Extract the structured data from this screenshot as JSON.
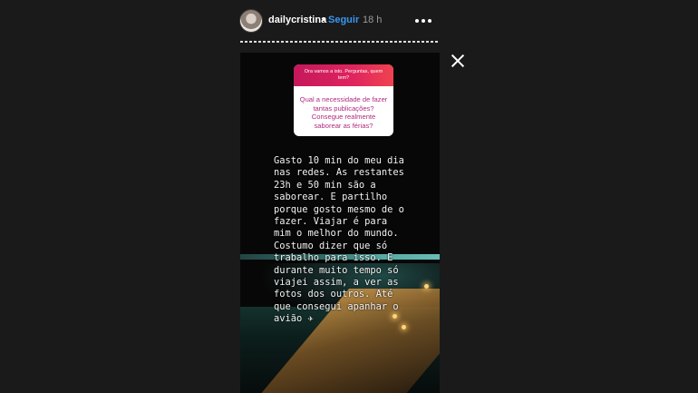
{
  "header": {
    "username": "dailycristina",
    "separator": "•",
    "follow_label": "Seguir",
    "time": "18 h"
  },
  "story": {
    "question_prompt": "Ora vamos a isto. Perguntas, quem tem?",
    "question_text": "Qual a necessidade de fazer tantas publicações? Consegue realmente saborear as férias?",
    "response_text": "Gasto 10 min do meu dia\nnas redes. As restantes\n23h e 50 min são a\nsaborear. E partilho\nporque gosto mesmo de o\nfazer. Viajar é para\nmim o melhor do mundo.\nCostumo dizer que só\ntrabalho para isso. E\ndurante muito tempo só\nviajei assim, a ver as\nfotos dos outros. Até\nque consegui apanhar o\navião ✈"
  },
  "icons": {
    "more": "more-options-icon",
    "close": "close-icon",
    "avatar": "avatar"
  }
}
